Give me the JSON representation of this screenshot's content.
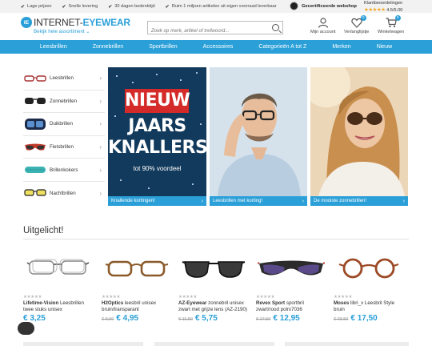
{
  "usp": [
    "Lage prijzen",
    "Snelle levering",
    "30 dagen bedenktijd",
    "Ruim 1 miljoen artikelen uit eigen voorraad leverbaar"
  ],
  "certified": "Gecertificeerde webshop",
  "reviews": {
    "label": "Klantbeoordelingen",
    "stars": "★★★★★",
    "score": "4.5/5.00"
  },
  "logo": {
    "mark": "IE",
    "part1": "INTERNET-",
    "part2": "EYEWEAR"
  },
  "assortment_link": "Bekijk hele assortiment ⌄",
  "search": {
    "placeholder": "Zoek op merk, artikel of trefwoord..."
  },
  "header_icons": [
    {
      "label": "Mijn account",
      "icon": "user-icon"
    },
    {
      "label": "Verlanglijstje",
      "icon": "heart-icon",
      "badge": "0"
    },
    {
      "label": "Winkelwagen",
      "icon": "cart-icon",
      "badge": "0"
    }
  ],
  "nav": [
    "Leesbrillen",
    "Zonnebrillen",
    "Sportbrillen",
    "Accessoires",
    "Categorieën A tot Z",
    "Merken",
    "Nieuw"
  ],
  "sidebar": [
    {
      "label": "Leesbrillen",
      "icon": "reading-glasses-icon"
    },
    {
      "label": "Zonnebrillen",
      "icon": "sunglasses-icon"
    },
    {
      "label": "Duikbrillen",
      "icon": "diving-mask-icon"
    },
    {
      "label": "Fietsbrillen",
      "icon": "cycling-glasses-icon"
    },
    {
      "label": "Brillenkokers",
      "icon": "glasses-case-icon"
    },
    {
      "label": "Nachtbrillen",
      "icon": "night-glasses-icon"
    }
  ],
  "banners": [
    {
      "line1": "NIEUW",
      "line2": "JAARS",
      "line3": "KNALLERS!",
      "sub": "tot 90% voordeel",
      "cta": "Knallende kortingen!"
    },
    {
      "cta": "Leesbrillen met korting!"
    },
    {
      "cta": "De mooiste zonnebrillen!"
    }
  ],
  "section_title": "Uitgelicht!",
  "products": [
    {
      "brand": "Lifetime-Vision",
      "name": "Leesbrillen twee stuks unisex",
      "old_price": "",
      "price": "€ 3,25",
      "stars": "★★★★★"
    },
    {
      "brand": "H2Optics",
      "name": "leesbril unisex bruin/transparant",
      "old_price": "€ 9,90",
      "price": "€ 4,95",
      "stars": "★★★★★"
    },
    {
      "brand": "AZ-Eyewear",
      "name": "zonnebril unisex zwart met grijze lens (AZ-2190)",
      "old_price": "€ 11,50",
      "price": "€ 5,75",
      "stars": "★★★★★"
    },
    {
      "brand": "Revex Sport",
      "name": "sportbril zwart/rood polrx7036",
      "old_price": "€ 17,50",
      "price": "€ 12,95",
      "stars": "★★★★★"
    },
    {
      "brand": "Moses",
      "name": "libri_x Leesbril Style bruin",
      "old_price": "€ 23,50",
      "price": "€ 17,50",
      "stars": "★★★★★"
    }
  ],
  "colors": {
    "accent": "#2a9fd8",
    "banner_red": "#d42a2a",
    "banner_navy": "#123a5c"
  }
}
